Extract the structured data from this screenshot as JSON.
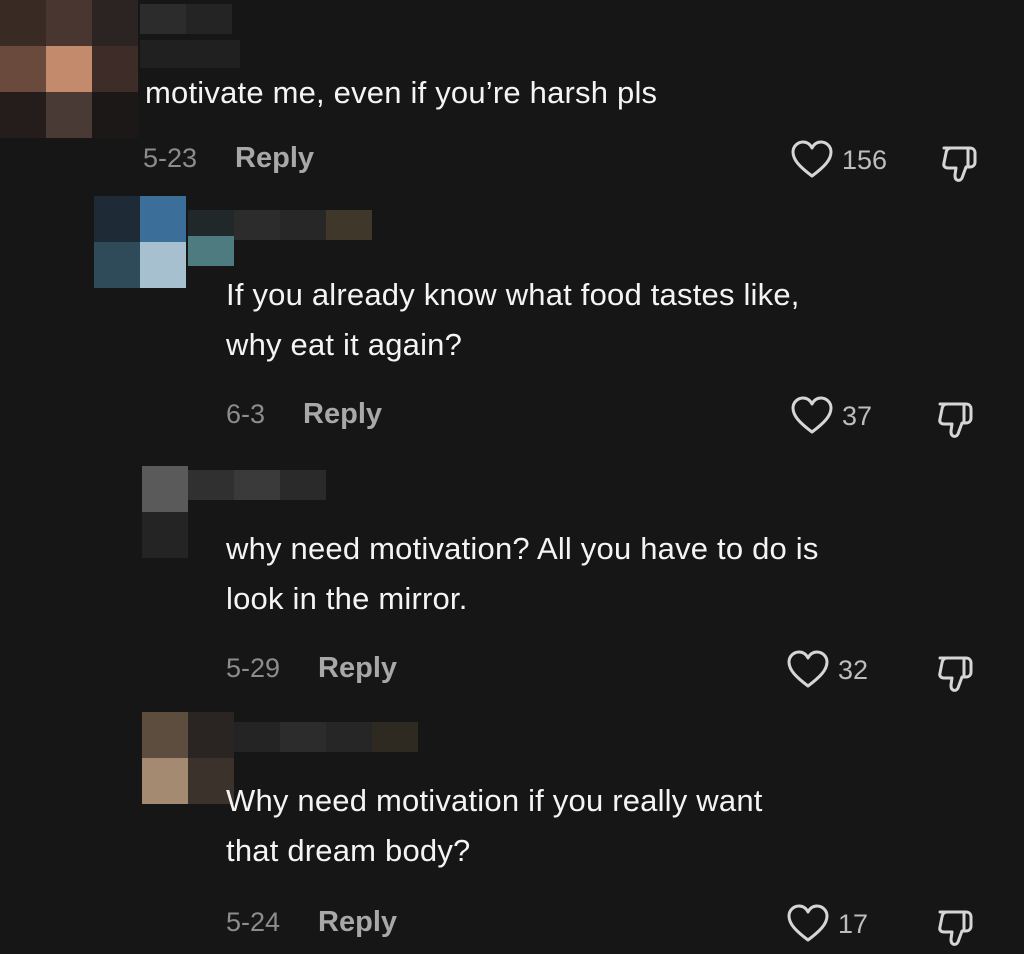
{
  "comments": [
    {
      "text_lines": [
        "motivate me, even if you’re harsh pls"
      ],
      "date": "5-23",
      "reply_label": "Reply",
      "like_count": "156"
    },
    {
      "text_lines": [
        "If you already know what food tastes like,",
        "why eat it again?"
      ],
      "date": "6-3",
      "reply_label": "Reply",
      "like_count": "37"
    },
    {
      "text_lines": [
        "why need motivation? All you have to do is",
        "look in the mirror."
      ],
      "date": "5-29",
      "reply_label": "Reply",
      "like_count": "32"
    },
    {
      "text_lines": [
        "Why need motivation if you really want",
        "that dream body?"
      ],
      "date": "5-24",
      "reply_label": "Reply",
      "like_count": "17"
    }
  ],
  "icons": {
    "like": "heart-outline-icon",
    "dislike": "thumbs-down-outline-icon"
  },
  "colors": {
    "background": "#161616",
    "text": "#f4f4f4",
    "muted": "#8c8c8c",
    "reply": "#a8a8a8"
  }
}
